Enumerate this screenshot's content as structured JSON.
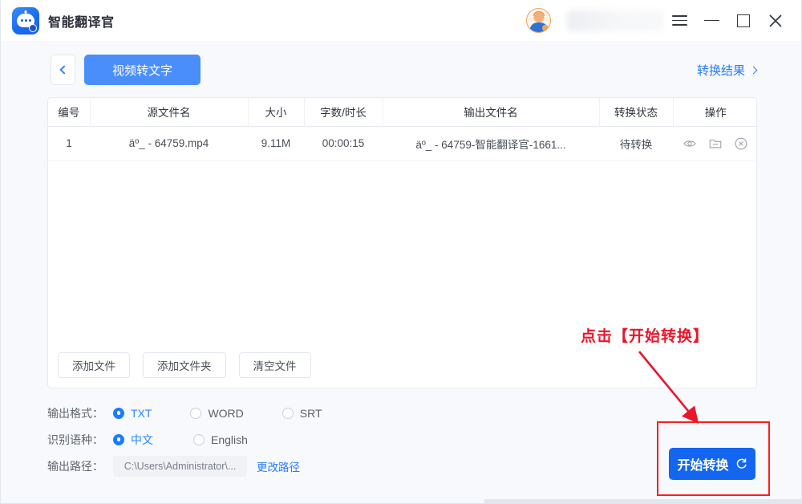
{
  "window": {
    "app_title": "智能翻译官",
    "logo_icon": "robot-chat-icon",
    "controls": {
      "menu": "menu-icon",
      "minimize": "minimize-icon",
      "maximize": "maximize-icon",
      "close": "close-icon"
    }
  },
  "toolbar": {
    "back_icon": "chevron-left-icon",
    "active_tab": "视频转文字",
    "result_link": "转换结果",
    "result_link_icon": "chevron-right-icon"
  },
  "table": {
    "columns": [
      "编号",
      "源文件名",
      "大小",
      "字数/时长",
      "输出文件名",
      "转换状态",
      "操作"
    ],
    "rows": [
      {
        "no": "1",
        "source_name": "äº_ - 64759.mp4",
        "size": "9.11M",
        "duration": "00:00:15",
        "output_name": "äº_ - 64759-智能翻译官-1661...",
        "status": "待转换",
        "ops": [
          "eye-icon",
          "folder-icon",
          "circle-close-icon"
        ]
      }
    ]
  },
  "panel_actions": {
    "add_file": "添加文件",
    "add_folder": "添加文件夹",
    "clear_files": "清空文件"
  },
  "settings": {
    "output_format": {
      "label": "输出格式：",
      "options": [
        "TXT",
        "WORD",
        "SRT"
      ],
      "selected": "TXT"
    },
    "language": {
      "label": "识别语种：",
      "options": [
        "中文",
        "English"
      ],
      "selected": "中文"
    },
    "output_path": {
      "label": "输出路径：",
      "value": "C:\\Users\\Administrator\\...",
      "change_link": "更改路径"
    }
  },
  "start": {
    "label": "开始转换",
    "icon": "refresh-icon"
  },
  "annotation": {
    "text": "点击【开始转换】",
    "arrow_icon": "arrow-down-right-icon",
    "color": "#e8162a",
    "highlight_color": "#ff1d1d"
  },
  "colors": {
    "accent": "#2a7bfb",
    "tab_blue": "#4a8efc",
    "primary_button": "#1366f0",
    "background": "#f7f9fc",
    "panel": "#ffffff"
  }
}
